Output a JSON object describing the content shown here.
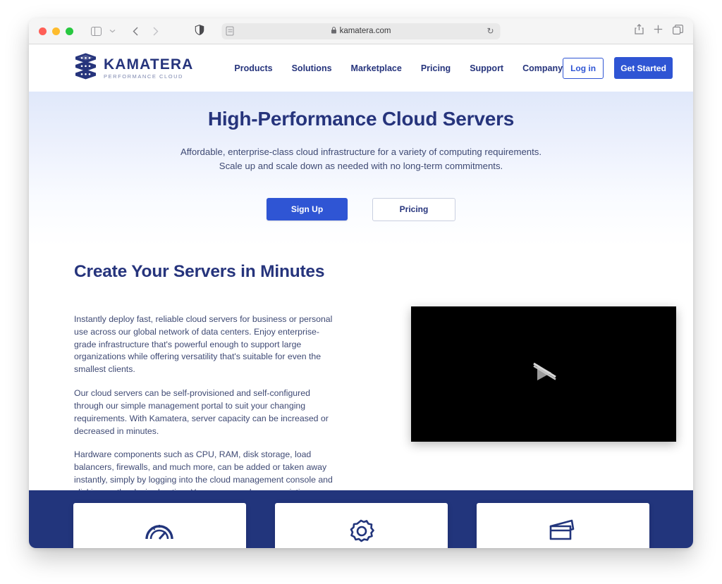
{
  "browser": {
    "traffic_lights": [
      "close",
      "minimize",
      "zoom"
    ],
    "sidebar_icon": "sidebar-icon",
    "chevron_icon": "chevron-down-icon",
    "back_icon": "back-arrow-icon",
    "forward_icon": "forward-arrow-icon",
    "shield_icon": "privacy-shield-icon",
    "reader_icon": "reader-view-icon",
    "lock_glyph": "\u0001F512",
    "lock_symbol": "▪",
    "url": "kamatera.com",
    "reload_glyph": "↻",
    "share_icon": "share-icon",
    "new_tab_icon": "plus-icon",
    "tabs_icon": "tab-overview-icon"
  },
  "site_header": {
    "logo": {
      "name": "KAMATERA",
      "tagline": "PERFORMANCE CLOUD",
      "icon": "stacked-layers-logo-icon"
    },
    "nav": [
      {
        "label": "Products"
      },
      {
        "label": "Solutions"
      },
      {
        "label": "Marketplace"
      },
      {
        "label": "Pricing"
      },
      {
        "label": "Support"
      },
      {
        "label": "Company"
      }
    ],
    "login_label": "Log in",
    "get_started_label": "Get Started"
  },
  "hero": {
    "title": "High-Performance Cloud Servers",
    "sub_line_1": "Affordable, enterprise-class cloud infrastructure for a variety of computing requirements.",
    "sub_line_2": "Scale up and scale down as needed with no long-term commitments.",
    "signup_label": "Sign Up",
    "pricing_label": "Pricing"
  },
  "section": {
    "title": "Create Your Servers in Minutes",
    "paragraphs": [
      "Instantly deploy fast, reliable cloud servers for business or personal use across our global network of data centers. Enjoy enterprise-grade infrastructure that's powerful enough to support large organizations while offering versatility that's suitable for even the smallest clients.",
      "Our cloud servers can be self-provisioned and self-configured through our simple management portal to suit your changing requirements. With Kamatera, server capacity can be increased or decreased in minutes.",
      "Hardware components such as CPU, RAM, disk storage, load balancers, firewalls, and much more, can be added or taken away instantly, simply by logging into the cloud management console and clicking on the desired option. You can even clone an existing server and deploy it within the same data center or at another location."
    ],
    "video": {
      "state": "paused-muted",
      "play_icon": "play-slash-icon"
    }
  },
  "cards": [
    {
      "icon": "speedometer-icon"
    },
    {
      "icon": "gear-icon"
    },
    {
      "icon": "card-stack-icon"
    }
  ],
  "colors": {
    "brand_navy": "#26347c",
    "band_navy": "#22357c",
    "accent_blue": "#2f55d4",
    "body_text": "#3f4a74",
    "hero_gradient_top": "#e0e8fa"
  }
}
